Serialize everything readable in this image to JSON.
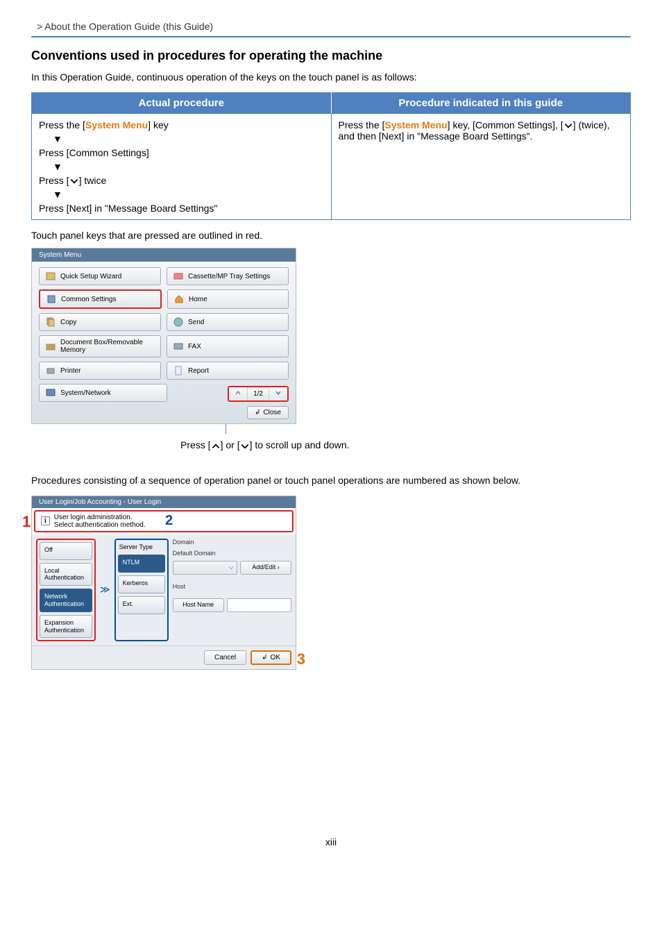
{
  "breadcrumb": "> About the Operation Guide (this Guide)",
  "heading": "Conventions used in procedures for operating the machine",
  "intro": "In this Operation Guide, continuous operation of the keys on the touch panel is as follows:",
  "table": {
    "h1": "Actual procedure",
    "h2": "Procedure indicated in this guide",
    "left": {
      "l1a": "Press the [",
      "l1b": "System Menu",
      "l1c": "] key",
      "l2": "Press [Common Settings]",
      "l3a": "Press [",
      "l3b": "] twice",
      "l4": "Press [Next] in \"Message Board Settings\""
    },
    "right": {
      "r1a": "Press the [",
      "r1b": "System Menu",
      "r1c": "] key, [Common Settings], [",
      "r1d": "] (twice), and then [Next] in \"Message Board Settings\"."
    }
  },
  "note_red": "Touch panel keys that are pressed are outlined in red.",
  "panel1": {
    "title": "System Menu",
    "btns": {
      "b1": "Quick Setup Wizard",
      "b2": "Cassette/MP Tray Settings",
      "b3": "Common Settings",
      "b4": "Home",
      "b5": "Copy",
      "b6": "Send",
      "b7": "Document Box/Removable Memory",
      "b8": "FAX",
      "b9": "Printer",
      "b10": "Report",
      "b11": "System/Network"
    },
    "pager": "1/2",
    "close": "Close"
  },
  "caption_a": "Press [",
  "caption_b": "] or [",
  "caption_c": "] to scroll up and down.",
  "procnote": "Procedures consisting of a sequence of operation panel or touch panel operations are numbered as shown below.",
  "panel2": {
    "title": "User Login/Job Accounting - User Login",
    "info1": "User login administration.",
    "info2": "Select authentication method.",
    "tabs1": {
      "t1": "Off",
      "t2": "Local Authentication",
      "t3": "Network Authentication",
      "t4": "Expansion Authentication"
    },
    "tabs2": {
      "h": "Server Type",
      "t1": "NTLM",
      "t2": "Kerberos",
      "t3": "Ext."
    },
    "domain": "Domain",
    "defdomain": "Default Domain",
    "addedit": "Add/Edit",
    "host": "Host",
    "hostname": "Host Name",
    "cancel": "Cancel",
    "ok": "OK"
  },
  "nums": {
    "n1": "1",
    "n2": "2",
    "n3": "3"
  },
  "pagenum": "xiii"
}
